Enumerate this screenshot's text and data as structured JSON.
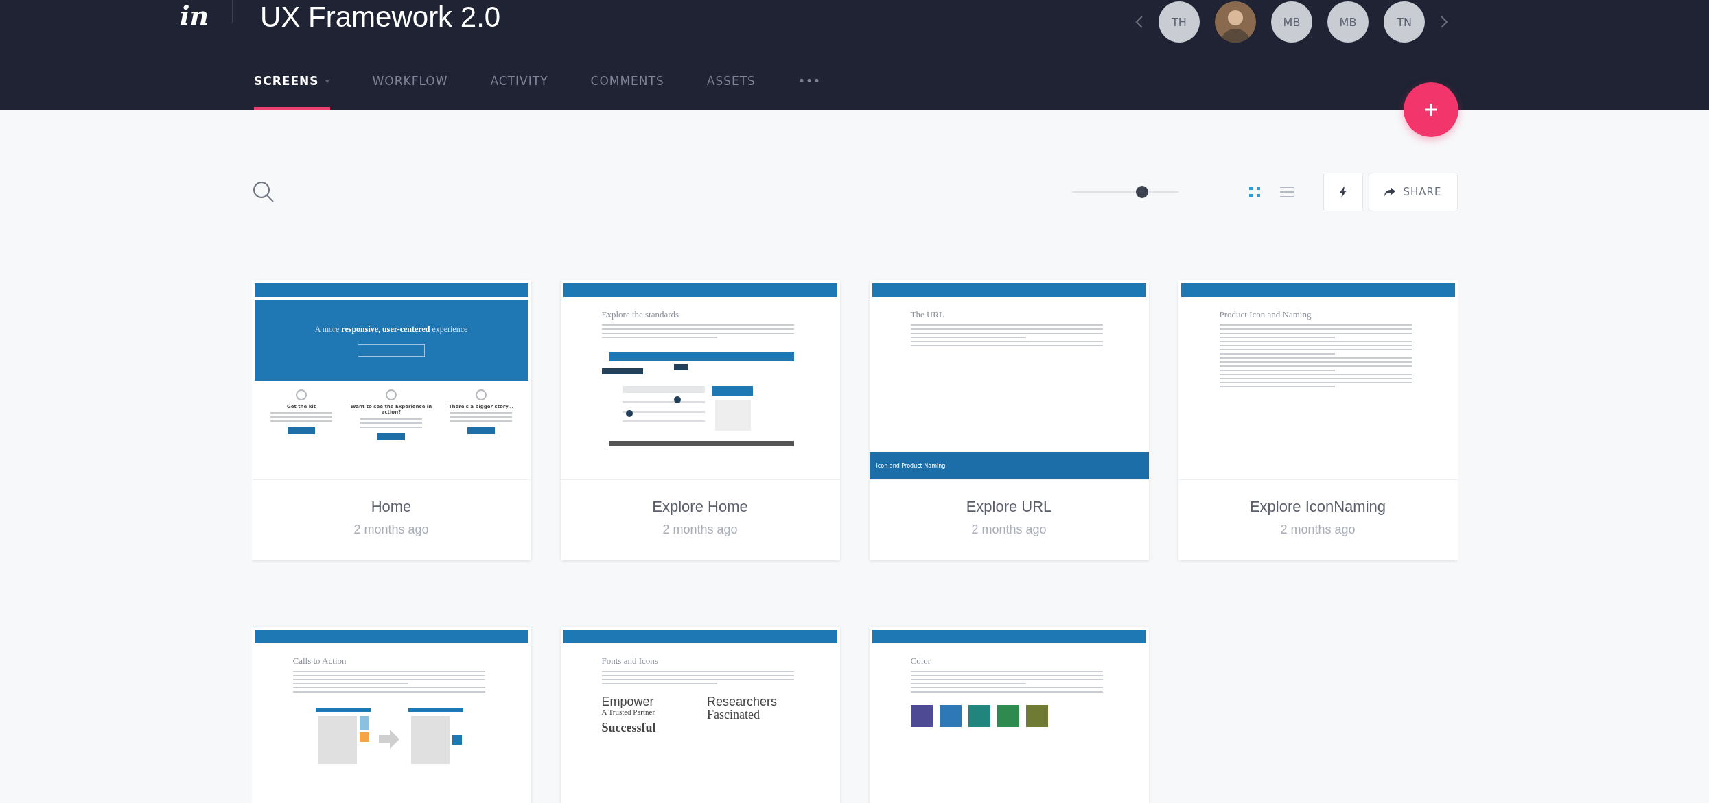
{
  "app": {
    "logo": "in",
    "title": "UX Framework 2.0"
  },
  "collaborators": [
    {
      "kind": "initials",
      "initials": "TH"
    },
    {
      "kind": "photo"
    },
    {
      "kind": "initials",
      "initials": "MB"
    },
    {
      "kind": "initials",
      "initials": "MB"
    },
    {
      "kind": "initials",
      "initials": "TN"
    }
  ],
  "tabs": [
    {
      "label": "SCREENS",
      "selected": true,
      "has_menu": true
    },
    {
      "label": "WORKFLOW",
      "selected": false,
      "has_menu": false
    },
    {
      "label": "ACTIVITY",
      "selected": false,
      "has_menu": false
    },
    {
      "label": "COMMENTS",
      "selected": false,
      "has_menu": false
    },
    {
      "label": "ASSETS",
      "selected": false,
      "has_menu": false
    },
    {
      "label": "•••",
      "selected": false,
      "has_menu": false
    }
  ],
  "toolbar": {
    "zoom": {
      "level": 0.66
    },
    "views": [
      {
        "kind": "grid",
        "selected": true
      },
      {
        "kind": "list",
        "selected": false
      }
    ],
    "share_label": "SHARE"
  },
  "screens": [
    {
      "name": "Home",
      "updated": "2 months ago",
      "thumbnail": {
        "kind": "hero",
        "headline": "A more **responsive, user-centered** experience",
        "features": [
          "Get the kit",
          "Want to see the Experience in action?",
          "There's a bigger story..."
        ]
      }
    },
    {
      "name": "Explore Home",
      "updated": "2 months ago",
      "thumbnail": {
        "kind": "diagram",
        "heading": "Explore the standards"
      }
    },
    {
      "name": "Explore URL",
      "updated": "2 months ago",
      "thumbnail": {
        "kind": "article",
        "heading": "The URL",
        "footer": "Icon and Product Naming"
      }
    },
    {
      "name": "Explore IconNaming",
      "updated": "2 months ago",
      "thumbnail": {
        "kind": "article",
        "heading": "Product Icon and Naming"
      }
    },
    {
      "thumbnail": {
        "kind": "cta",
        "heading": "Calls to Action"
      }
    },
    {
      "thumbnail": {
        "kind": "type",
        "heading": "Fonts and Icons",
        "samples": [
          "Empower",
          "Researchers",
          "A Trusted Partner",
          "Fascinated",
          "Successful"
        ]
      }
    },
    {
      "thumbnail": {
        "kind": "swatches",
        "heading": "Color",
        "swatches": [
          {
            "color": "#4e4a94"
          },
          {
            "color": "#2f78b8"
          },
          {
            "color": "#21857d"
          },
          {
            "color": "#2f8a4f"
          },
          {
            "color": "#6f7a33"
          }
        ]
      }
    }
  ]
}
